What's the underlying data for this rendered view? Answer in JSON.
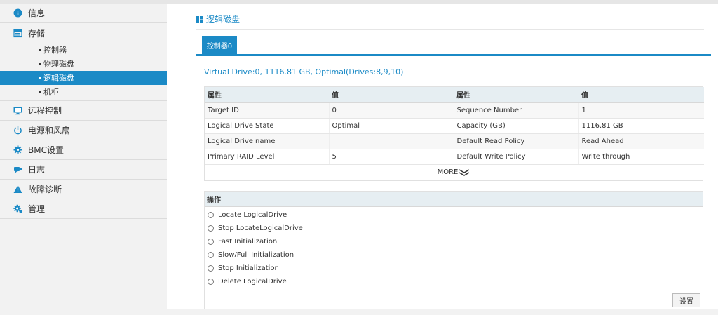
{
  "sidebar": {
    "items": [
      {
        "label": "信息",
        "icon": "info-icon"
      },
      {
        "label": "存储",
        "icon": "storage-icon",
        "children": [
          {
            "label": "控制器"
          },
          {
            "label": "物理磁盘"
          },
          {
            "label": "逻辑磁盘",
            "active": true
          },
          {
            "label": "机柜"
          }
        ]
      },
      {
        "label": "远程控制",
        "icon": "monitor-icon"
      },
      {
        "label": "电源和风扇",
        "icon": "power-icon"
      },
      {
        "label": "BMC设置",
        "icon": "gear-icon"
      },
      {
        "label": "日志",
        "icon": "log-icon"
      },
      {
        "label": "故障诊断",
        "icon": "warning-icon"
      },
      {
        "label": "管理",
        "icon": "admin-gear-icon"
      }
    ]
  },
  "page": {
    "title": "逻辑磁盘",
    "tab": "控制器0",
    "summary": "Virtual Drive:0, 1116.81 GB, Optimal(Drives:8,9,10)"
  },
  "props": {
    "headers": [
      "属性",
      "值",
      "属性",
      "值"
    ],
    "rows": [
      [
        "Target ID",
        "0",
        "Sequence Number",
        "1"
      ],
      [
        "Logical Drive State",
        "Optimal",
        "Capacity (GB)",
        "1116.81 GB"
      ],
      [
        "Logical Drive name",
        "",
        "Default Read Policy",
        "Read Ahead"
      ],
      [
        "Primary RAID Level",
        "5",
        "Default Write Policy",
        "Write through"
      ]
    ],
    "more": "MORE"
  },
  "ops": {
    "header": "操作",
    "options": [
      "Locate LogicalDrive",
      "Stop LocateLogicalDrive",
      "Fast Initialization",
      "Slow/Full Initialization",
      "Stop Initialization",
      "Delete LogicalDrive"
    ],
    "submit": "设置"
  },
  "colors": {
    "accent": "#1b8ac6",
    "sidebar_bg": "#f2f2f2",
    "header_bg": "#e6eef2"
  }
}
